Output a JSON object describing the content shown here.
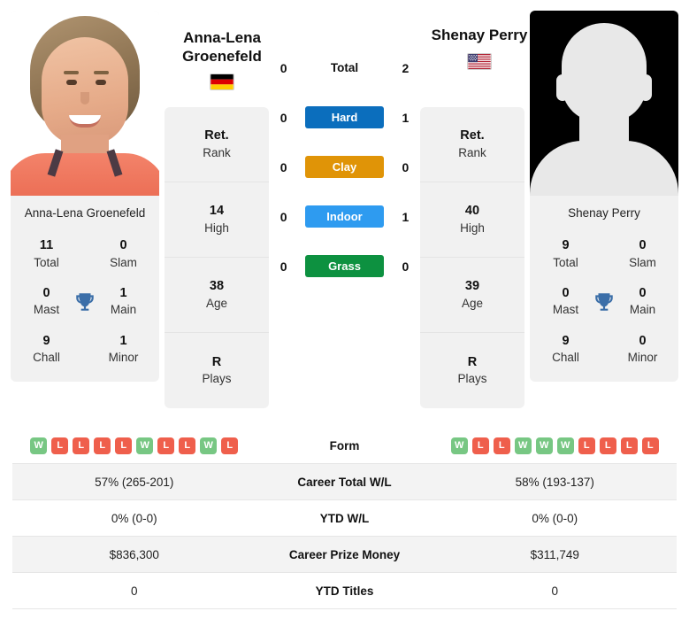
{
  "players": {
    "left": {
      "name": "Anna-Lena Groenefeld",
      "name_line1": "Anna-Lena",
      "name_line2": "Groenefeld",
      "photo_caption": "Anna-Lena Groenefeld",
      "country": "Germany",
      "flag_icon": "flag-germany",
      "info": [
        {
          "value": "Ret.",
          "label": "Rank"
        },
        {
          "value": "14",
          "label": "High"
        },
        {
          "value": "38",
          "label": "Age"
        },
        {
          "value": "R",
          "label": "Plays"
        }
      ],
      "titles": {
        "total": "11",
        "total_label": "Total",
        "slam": "0",
        "slam_label": "Slam",
        "mast": "0",
        "mast_label": "Mast",
        "main": "1",
        "main_label": "Main",
        "chall": "9",
        "chall_label": "Chall",
        "minor": "1",
        "minor_label": "Minor"
      },
      "form": [
        "W",
        "L",
        "L",
        "L",
        "L",
        "W",
        "L",
        "L",
        "W",
        "L"
      ],
      "career_total_wl": "57% (265-201)",
      "ytd_wl": "0% (0-0)",
      "career_prize_money": "$836,300",
      "ytd_titles": "0"
    },
    "right": {
      "name": "Shenay Perry",
      "name_line1": "Shenay Perry",
      "name_line2": "",
      "photo_caption": "Shenay Perry",
      "country": "United States",
      "flag_icon": "flag-usa",
      "info": [
        {
          "value": "Ret.",
          "label": "Rank"
        },
        {
          "value": "40",
          "label": "High"
        },
        {
          "value": "39",
          "label": "Age"
        },
        {
          "value": "R",
          "label": "Plays"
        }
      ],
      "titles": {
        "total": "9",
        "total_label": "Total",
        "slam": "0",
        "slam_label": "Slam",
        "mast": "0",
        "mast_label": "Mast",
        "main": "0",
        "main_label": "Main",
        "chall": "9",
        "chall_label": "Chall",
        "minor": "0",
        "minor_label": "Minor"
      },
      "form": [
        "W",
        "L",
        "L",
        "W",
        "W",
        "W",
        "L",
        "L",
        "L",
        "L"
      ],
      "career_total_wl": "58% (193-137)",
      "ytd_wl": "0% (0-0)",
      "career_prize_money": "$311,749",
      "ytd_titles": "0"
    }
  },
  "head_to_head": {
    "rows": [
      {
        "label": "Total",
        "left": "0",
        "right": "2",
        "color": ""
      },
      {
        "label": "Hard",
        "left": "0",
        "right": "1",
        "color": "#0b6ebd"
      },
      {
        "label": "Clay",
        "left": "0",
        "right": "0",
        "color": "#e09407"
      },
      {
        "label": "Indoor",
        "left": "0",
        "right": "1",
        "color": "#2e9bf0"
      },
      {
        "label": "Grass",
        "left": "0",
        "right": "0",
        "color": "#0d9140"
      }
    ]
  },
  "table": {
    "rows": [
      {
        "label": "Form",
        "type": "form"
      },
      {
        "label": "Career Total W/L",
        "type": "text",
        "key": "career_total_wl"
      },
      {
        "label": "YTD W/L",
        "type": "text",
        "key": "ytd_wl"
      },
      {
        "label": "Career Prize Money",
        "type": "text",
        "key": "career_prize_money"
      },
      {
        "label": "YTD Titles",
        "type": "text",
        "key": "ytd_titles"
      }
    ]
  },
  "icons": {
    "trophy": "trophy-icon"
  },
  "colors": {
    "win": "#77c783",
    "loss": "#ef5f4c",
    "hard": "#0b6ebd",
    "clay": "#e09407",
    "indoor": "#2e9bf0",
    "grass": "#0d9140",
    "trophy": "#3b6ea8",
    "card_bg": "#f1f1f1"
  }
}
